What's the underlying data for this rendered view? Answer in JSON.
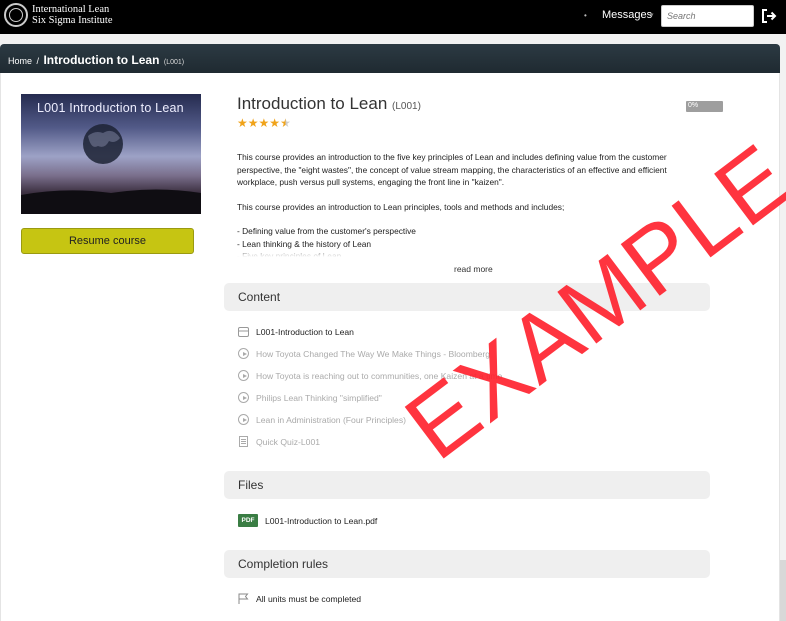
{
  "header": {
    "logo_line1": "International Lean",
    "logo_line2": "Six Sigma Institute",
    "nav_marker": "•",
    "messages_label": "Messages",
    "messages_caret": "▾",
    "search_placeholder": "Search"
  },
  "breadcrumb": {
    "home": "Home",
    "separator": "/",
    "title": "Introduction to Lean",
    "code": "(L001)"
  },
  "course": {
    "image_title": "L001  Introduction to Lean",
    "resume_label": "Resume course",
    "title": "Introduction to Lean",
    "code": "(L001)",
    "rating": 4.5,
    "progress_percent": 0,
    "progress_label": "0%",
    "description": [
      "This course provides an introduction to the five key principles of Lean and includes defining value from the customer perspective, the \"eight wastes\", the concept of value stream mapping, the characteristics of an effective and efficient workplace, push versus pull systems, engaging the front line in \"kaizen\".",
      "This course provides an introduction to Lean principles, tools and methods and includes;",
      "- Defining value from the customer's perspective\n- Lean thinking & the history of Lean\n- Five key principles of Lean"
    ],
    "read_more": "read more"
  },
  "content": {
    "heading": "Content",
    "items": [
      {
        "label": "L001-Introduction to Lean",
        "icon": "module-icon",
        "enabled": true
      },
      {
        "label": "How Toyota Changed The Way We Make Things - Bloomberg",
        "icon": "play-icon",
        "enabled": false
      },
      {
        "label": "How Toyota is reaching out to communities, one Kaizen at a time",
        "icon": "play-icon",
        "enabled": false
      },
      {
        "label": "Philips Lean Thinking \"simplified\"",
        "icon": "play-icon",
        "enabled": false
      },
      {
        "label": "Lean in Administration (Four Principles)",
        "icon": "play-icon",
        "enabled": false
      },
      {
        "label": "Quick Quiz-L001",
        "icon": "quiz-icon",
        "enabled": false
      }
    ]
  },
  "files": {
    "heading": "Files",
    "items": [
      {
        "badge": "PDF",
        "label": "L001-Introduction to Lean.pdf"
      }
    ]
  },
  "completion": {
    "heading": "Completion rules",
    "rules": [
      "All units must be completed"
    ]
  },
  "watermark": "EXAMPLE",
  "colors": {
    "topbar": "#000000",
    "breadcrumb": "#26323a",
    "resume_button": "#c6c512",
    "stars": "#f0a31a",
    "watermark": "#ff1f2b",
    "pdf_badge": "#3a7d44"
  }
}
